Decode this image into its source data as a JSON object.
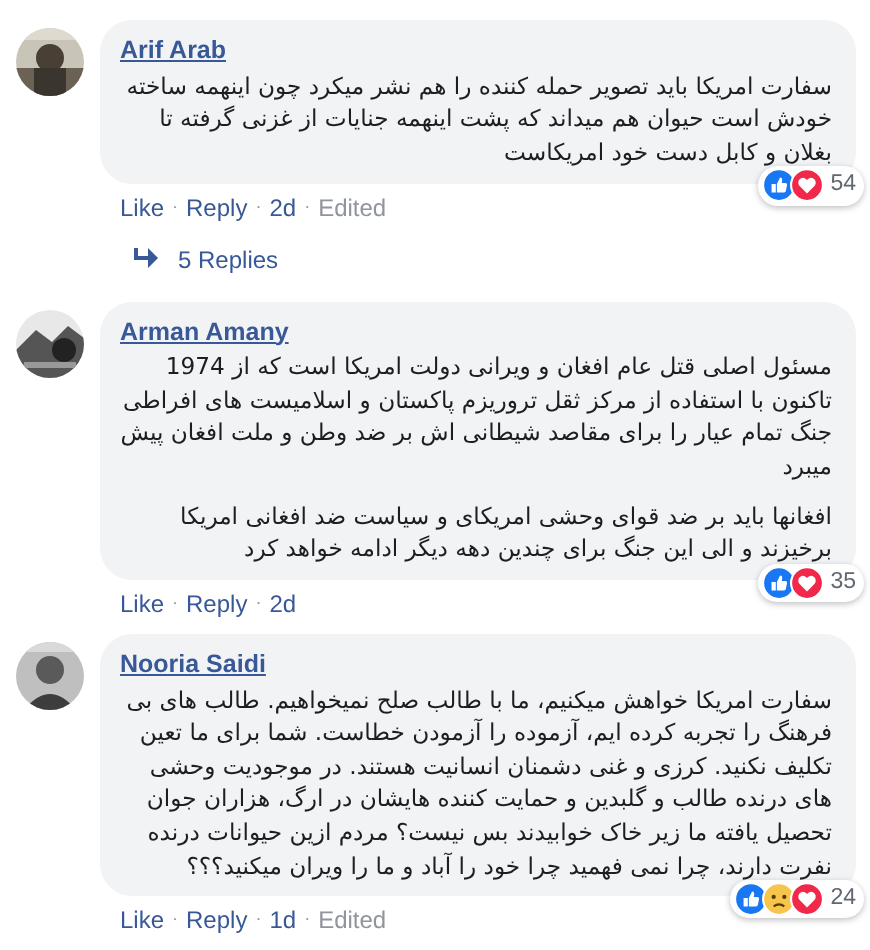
{
  "separator": "·",
  "comments": [
    {
      "author": "Arif Arab",
      "paragraphs": [
        "سفارت امریکا باید تصویر حمله کننده را هم نشر میکرد چون اینهمه ساخته خودش است حیوان هم میداند که پشت اینهمه جنایات از غزنی گرفته تا بغلان و کابل دست خود امریکاست"
      ],
      "reactions": [
        {
          "kind": "like"
        },
        {
          "kind": "love"
        }
      ],
      "reaction_count": "54",
      "like": "Like",
      "reply": "Reply",
      "time": "2d",
      "edited": "Edited",
      "replies": "5 Replies"
    },
    {
      "author": "Arman Amany",
      "paragraphs": [
        "مسئول اصلی قتل عام افغان و ویرانی دولت امریکا است که از 1974 تاکنون با استفاده از مرکز ثقل تروریزم پاکستان و اسلامیست های افراطی جنگ تمام عیار را برای مقاصد شیطانی اش بر ضد وطن و ملت افغان پیش میبرد",
        "افغانها باید بر ضد قوای وحشی امریکای و سیاست ضد افغانی امریکا برخیزند و الی این جنگ برای چندین دهه دیگر ادامه خواهد کرد"
      ],
      "reactions": [
        {
          "kind": "like"
        },
        {
          "kind": "love"
        }
      ],
      "reaction_count": "35",
      "like": "Like",
      "reply": "Reply",
      "time": "2d"
    },
    {
      "author": "Nooria Saidi",
      "paragraphs": [
        "سفارت امریکا خواهش میکنیم، ما با طالب صلح نمیخواهیم. طالب های بی فرهنگ را تجربه کرده ایم، آزموده را آزمودن خطاست. شما برای ما تعین تکلیف نکنید. کرزی و غنی دشمنان انسانیت هستند. در موجودیت وحشی های درنده طالب و گلبدین و حمایت کننده هایشان در ارگ، هزاران جوان تحصیل یافته ما زیر خاک خوابیدند بس نیست؟ مردم ازین حیوانات درنده نفرت دارند، چرا نمی فهمید چرا خود را آباد و ما را ویران میکنید؟؟؟"
      ],
      "reactions": [
        {
          "kind": "like"
        },
        {
          "kind": "sad"
        },
        {
          "kind": "love"
        }
      ],
      "reaction_count": "24",
      "like": "Like",
      "reply": "Reply",
      "time": "1d",
      "edited": "Edited"
    }
  ]
}
